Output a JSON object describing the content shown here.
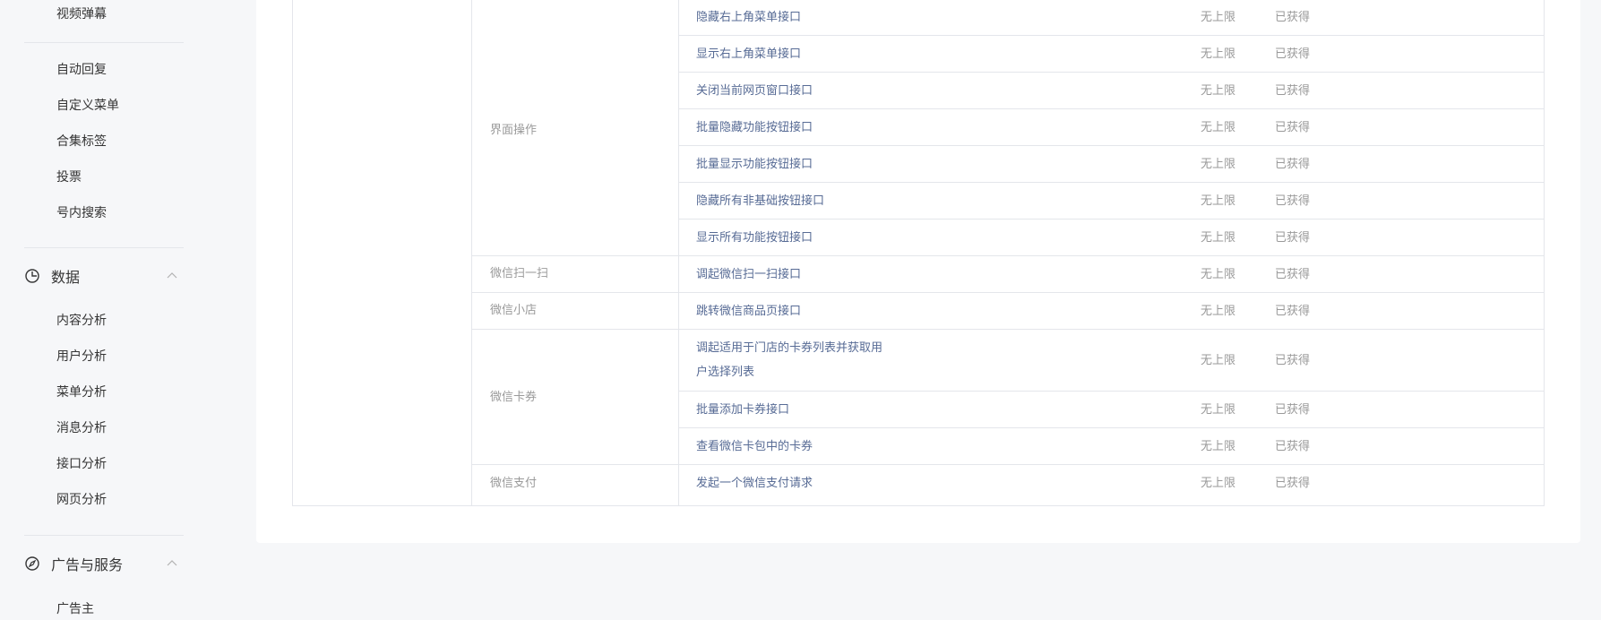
{
  "sidebar": {
    "items_top": [
      "视频弹幕"
    ],
    "items_group1": [
      "自动回复",
      "自定义菜单",
      "合集标签",
      "投票",
      "号内搜索"
    ],
    "groups": [
      {
        "label": "数据",
        "icon": "pie-chart-icon",
        "items": [
          "内容分析",
          "用户分析",
          "菜单分析",
          "消息分析",
          "接口分析",
          "网页分析"
        ]
      },
      {
        "label": "广告与服务",
        "icon": "compass-icon",
        "items": [
          "广告主"
        ]
      }
    ]
  },
  "table": {
    "rows": [
      {
        "category": "界面操作",
        "api": "隐藏右上角菜单接口",
        "limit": "无上限",
        "status": "已获得"
      },
      {
        "category": "界面操作",
        "api": "显示右上角菜单接口",
        "limit": "无上限",
        "status": "已获得"
      },
      {
        "category": "界面操作",
        "api": "关闭当前网页窗口接口",
        "limit": "无上限",
        "status": "已获得"
      },
      {
        "category": "界面操作",
        "api": "批量隐藏功能按钮接口",
        "limit": "无上限",
        "status": "已获得"
      },
      {
        "category": "界面操作",
        "api": "批量显示功能按钮接口",
        "limit": "无上限",
        "status": "已获得"
      },
      {
        "category": "界面操作",
        "api": "隐藏所有非基础按钮接口",
        "limit": "无上限",
        "status": "已获得"
      },
      {
        "category": "界面操作",
        "api": "显示所有功能按钮接口",
        "limit": "无上限",
        "status": "已获得"
      },
      {
        "category": "微信扫一扫",
        "api": "调起微信扫一扫接口",
        "limit": "无上限",
        "status": "已获得"
      },
      {
        "category": "微信小店",
        "api": "跳转微信商品页接口",
        "limit": "无上限",
        "status": "已获得"
      },
      {
        "category": "微信卡券",
        "api": "调起适用于门店的卡券列表并获取用户选择列表",
        "limit": "无上限",
        "status": "已获得"
      },
      {
        "category": "微信卡券",
        "api": "批量添加卡券接口",
        "limit": "无上限",
        "status": "已获得"
      },
      {
        "category": "微信卡券",
        "api": "查看微信卡包中的卡券",
        "limit": "无上限",
        "status": "已获得"
      },
      {
        "category": "微信支付",
        "api": "发起一个微信支付请求",
        "limit": "无上限",
        "status": "已获得"
      }
    ]
  }
}
